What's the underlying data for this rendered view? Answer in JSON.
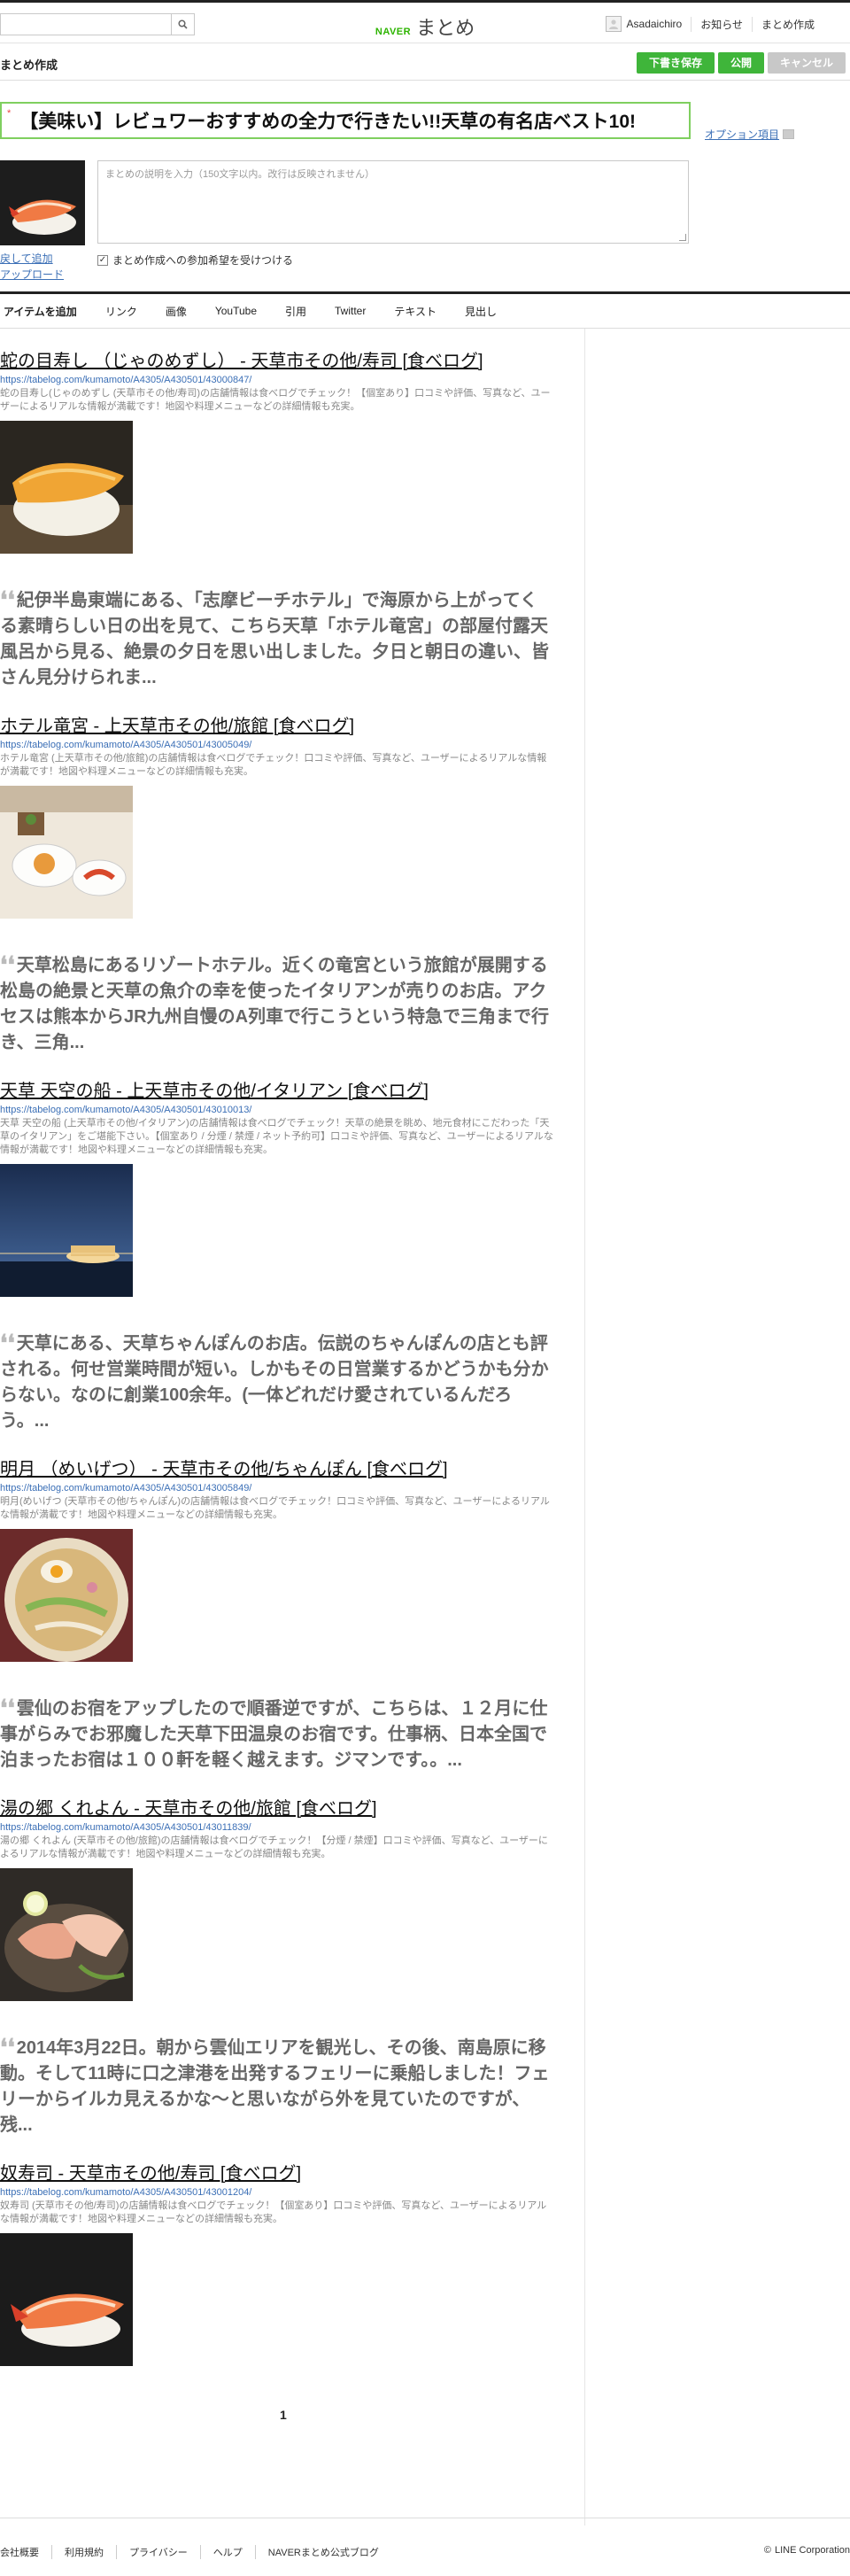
{
  "header": {
    "search_placeholder": "",
    "logo_naver": "NAVER",
    "logo_matome": "まとめ",
    "username": "Asadaichiro",
    "nav": [
      "お知らせ",
      "まとめ作成"
    ]
  },
  "subheader": {
    "title": "まとめ作成",
    "buttons": {
      "draft": "下書き保存",
      "publish": "公開",
      "cancel": "キャンセル"
    }
  },
  "editor": {
    "required_mark": "*",
    "title": "【美味い】レビュワーおすすめの全力で行きたい!!天草の有名店ベスト10!",
    "option_link": "オプション項目",
    "description_placeholder": "まとめの説明を入力（150文字以内。改行は反映されません）",
    "thumb_links": [
      "戻して追加",
      "アップロード"
    ],
    "participate_label": "まとめ作成への参加希望を受けつける",
    "participate_checked": true
  },
  "tabs": [
    "アイテムを追加",
    "リンク",
    "画像",
    "YouTube",
    "引用",
    "Twitter",
    "テキスト",
    "見出し"
  ],
  "items": [
    {
      "title": "蛇の目寿し （じゃのめずし） - 天草市その他/寿司 [食べログ]",
      "url": "https://tabelog.com/kumamoto/A4305/A430501/43000847/",
      "desc": "蛇の目寿し(じゃのめずし (天草市その他/寿司)の店舗情報は食べログでチェック！【個室あり】口コミや評価、写真など、ユーザーによるリアルな情報が満載です！地図や料理メニューなどの詳細情報も充実。",
      "image": "sushi"
    },
    {
      "quote": "紀伊半島東端にある、「志摩ビーチホテル」で海原から上がってくる素晴らしい日の出を見て、こちら天草「ホテル竜宮」の部屋付露天風呂から見る、絶景の夕日を思い出しました。夕日と朝日の違い、皆さん見分けられま..."
    },
    {
      "title": "ホテル竜宮 - 上天草市その他/旅館 [食べログ]",
      "url": "https://tabelog.com/kumamoto/A4305/A430501/43005049/",
      "desc": "ホテル竜宮 (上天草市その他/旅館)の店舗情報は食べログでチェック！口コミや評価、写真など、ユーザーによるリアルな情報が満載です！地図や料理メニューなどの詳細情報も充実。",
      "image": "ryokan"
    },
    {
      "quote": "天草松島にあるリゾートホテル。近くの竜宮という旅館が展開する松島の絶景と天草の魚介の幸を使ったイタリアンが売りのお店。アクセスは熊本からJR九州自慢のA列車で行こうという特急で三角まで行き、三角..."
    },
    {
      "title": "天草 天空の船 - 上天草市その他/イタリアン [食べログ]",
      "url": "https://tabelog.com/kumamoto/A4305/A430501/43010013/",
      "desc": "天草 天空の船 (上天草市その他/イタリアン)の店舗情報は食べログでチェック！天草の絶景を眺め、地元食材にこだわった「天草のイタリアン」をご堪能下さい。【個室あり / 分煙 / 禁煙 / ネット予約可】口コミや評価、写真など、ユーザーによるリアルな情報が満載です！地図や料理メニューなどの詳細情報も充実。",
      "image": "sunset"
    },
    {
      "quote": "天草にある、天草ちゃんぽんのお店。伝説のちゃんぽんの店とも評される。何せ営業時間が短い。しかもその日営業するかどうかも分からない。なのに創業100余年。(一体どれだけ愛されているんだろう。..."
    },
    {
      "title": "明月 （めいげつ） - 天草市その他/ちゃんぽん [食べログ]",
      "url": "https://tabelog.com/kumamoto/A4305/A430501/43005849/",
      "desc": "明月(めいげつ (天草市その他/ちゃんぽん)の店舗情報は食べログでチェック！口コミや評価、写真など、ユーザーによるリアルな情報が満載です！地図や料理メニューなどの詳細情報も充実。",
      "image": "champon"
    },
    {
      "quote": "雲仙のお宿をアップしたので順番逆ですが、こちらは、１２月に仕事がらみでお邪魔した天草下田温泉のお宿です。仕事柄、日本全国で泊まったお宿は１００軒を軽く越えます。ジマンです。。..."
    },
    {
      "title": "湯の郷 くれよん - 天草市その他/旅館 [食べログ]",
      "url": "https://tabelog.com/kumamoto/A4305/A430501/43011839/",
      "desc": "湯の郷 くれよん (天草市その他/旅館)の店舗情報は食べログでチェック！【分煙 / 禁煙】口コミや評価、写真など、ユーザーによるリアルな情報が満載です！地図や料理メニューなどの詳細情報も充実。",
      "image": "sashimi"
    },
    {
      "quote": "2014年3月22日。朝から雲仙エリアを観光し、その後、南島原に移動。そして11時に口之津港を出発するフェリーに乗船しました！フェリーからイルカ見えるかな～と思いながら外を見ていたのですが、残..."
    },
    {
      "title": "奴寿司 - 天草市その他/寿司 [食べログ]",
      "url": "https://tabelog.com/kumamoto/A4305/A430501/43001204/",
      "desc": "奴寿司 (天草市その他/寿司)の店舗情報は食べログでチェック！【個室あり】口コミや評価、写真など、ユーザーによるリアルな情報が満載です！地図や料理メニューなどの詳細情報も充実。",
      "image": "ebi"
    }
  ],
  "pager": {
    "current": "1"
  },
  "footer": {
    "links": [
      "会社概要",
      "利用規約",
      "プライバシー",
      "ヘルプ",
      "NAVERまとめ公式ブログ"
    ],
    "copyright_symbol": "©",
    "copyright": "LINE Corporation"
  },
  "colors": {
    "accent_green": "#3fb53a",
    "title_border": "#7fcf5f",
    "link_blue": "#3b6fb6"
  }
}
